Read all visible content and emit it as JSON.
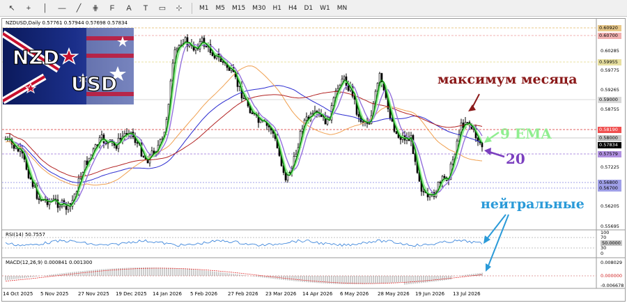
{
  "toolbar": {
    "tools": [
      {
        "name": "cursor-icon",
        "glyph": "↖"
      },
      {
        "name": "crosshair-icon",
        "glyph": "+"
      },
      {
        "name": "vertical-line-icon",
        "glyph": "│"
      },
      {
        "name": "horizontal-line-icon",
        "glyph": "—"
      },
      {
        "name": "trendline-icon",
        "glyph": "╱"
      },
      {
        "name": "equidistant-channel-icon",
        "glyph": "⋕"
      },
      {
        "name": "fibonacci-icon",
        "glyph": "F"
      },
      {
        "name": "text-icon",
        "glyph": "A"
      },
      {
        "name": "text-label-icon",
        "glyph": "T"
      },
      {
        "name": "rectangle-icon",
        "glyph": "▭"
      },
      {
        "name": "shapes-menu-icon",
        "glyph": "⊹"
      }
    ],
    "timeframes": [
      "M1",
      "M5",
      "M15",
      "M30",
      "H1",
      "H4",
      "D1",
      "W1",
      "MN"
    ]
  },
  "chart": {
    "symbol_label": "NZDUSD,Daily  0.57761 0.57944 0.57698 0.57834",
    "flag_text_top": "NZD",
    "flag_text_bottom": "USD",
    "annotations": {
      "month_max": "максимум месяца",
      "ema": "9 EMA",
      "twenty": "20",
      "neutral": "нейтральные"
    },
    "rsi_label": "RSI(14) 50.7557",
    "macd_label": "MACD(12,26,9) 0.000841 0.001300",
    "price_labels": [
      "0.60920",
      "0.60700",
      "0.60285",
      "0.59955",
      "0.59775",
      "0.59265",
      "0.59000",
      "0.58755",
      "0.58190",
      "0.58000",
      "0.57834",
      "0.57579",
      "0.57225",
      "0.56800",
      "0.56700",
      "0.56205",
      "0.55695"
    ],
    "rsi_scale": [
      "100",
      "70",
      "50.0000",
      "30",
      "0"
    ],
    "macd_scale": [
      "0.008029",
      "0.000000",
      "-0.006678"
    ],
    "dates": [
      "14 Oct 2025",
      "5 Nov 2025",
      "27 Nov 2025",
      "19 Dec 2025",
      "14 Jan 2026",
      "5 Feb 2026",
      "27 Feb 2026",
      "23 Mar 2026",
      "14 Apr 2026",
      "6 May 2026",
      "28 May 2026",
      "19 Jun 2026",
      "13 Jul 2026"
    ],
    "colors": {
      "bull_candle": "#000000",
      "ema9": "#008000",
      "ema9_light": "#90ee90",
      "ma20": "#9370db",
      "ma_orange": "#f0a050",
      "ma_red": "#b22222",
      "ma_blue": "#2b2bd0",
      "annotation_red": "#8b1a1a",
      "annotation_blue": "#2a9ad8",
      "annotation_purple": "#7b3fbf"
    }
  }
}
